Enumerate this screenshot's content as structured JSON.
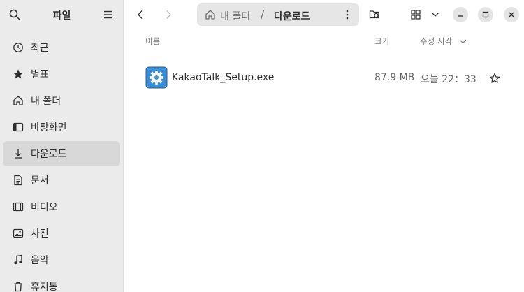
{
  "sidebar": {
    "title": "파일",
    "items": [
      {
        "label": "최근",
        "icon": "clock-icon"
      },
      {
        "label": "별표",
        "icon": "star-icon"
      },
      {
        "label": "내 폴더",
        "icon": "home-icon"
      },
      {
        "label": "바탕화면",
        "icon": "desktop-icon"
      },
      {
        "label": "다운로드",
        "icon": "download-icon",
        "active": true
      },
      {
        "label": "문서",
        "icon": "document-icon"
      },
      {
        "label": "비디오",
        "icon": "video-icon"
      },
      {
        "label": "사진",
        "icon": "picture-icon"
      },
      {
        "label": "음악",
        "icon": "music-icon"
      },
      {
        "label": "휴지통",
        "icon": "trash-icon"
      }
    ]
  },
  "pathbar": {
    "segment1": "내 폴더",
    "separator": "/",
    "segment2": "다운로드"
  },
  "columns": {
    "name": "이름",
    "size": "크기",
    "modified": "수정 시각"
  },
  "files": [
    {
      "name": "KakaoTalk_Setup.exe",
      "size": "87.9 MB",
      "modified": "오늘 22：33",
      "icon": "executable-gear-icon"
    }
  ],
  "colors": {
    "sidebar_bg": "#ebebeb",
    "active_item_bg": "#d8d8d8",
    "file_icon_blue": "#3a8fd6"
  }
}
